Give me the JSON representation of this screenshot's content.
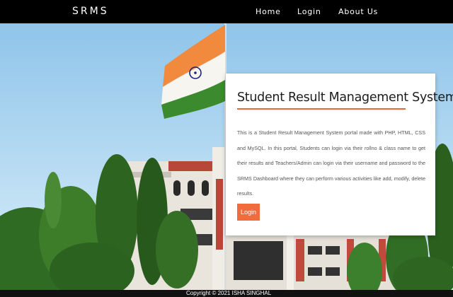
{
  "navbar": {
    "brand": "SRMS",
    "links": [
      "Home",
      "Login",
      "About Us"
    ]
  },
  "hero_card": {
    "title": "Student Result Management System",
    "description": "This is a Student Result Management System portal made with PHP, HTML, CSS and MySQL. In this portal, Students can login via their rollno & class name to get their results and Teachers/Admin can login via their username and password to the SRMS Dashboard where they can perform various activities like add, modify, delete results.",
    "login_button": "Login"
  },
  "footer": {
    "text": "Copyright © 2021 ISHA SINGHAL"
  },
  "colors": {
    "navbar_bg": "#000000",
    "accent": "#f26b3a",
    "underline": "#e8682f",
    "card_bg": "#ffffff",
    "flag_saffron": "#f28a3e",
    "flag_green": "#3b8a2e",
    "chakra_blue": "#1a237e",
    "sky": "#a9d2ee"
  }
}
